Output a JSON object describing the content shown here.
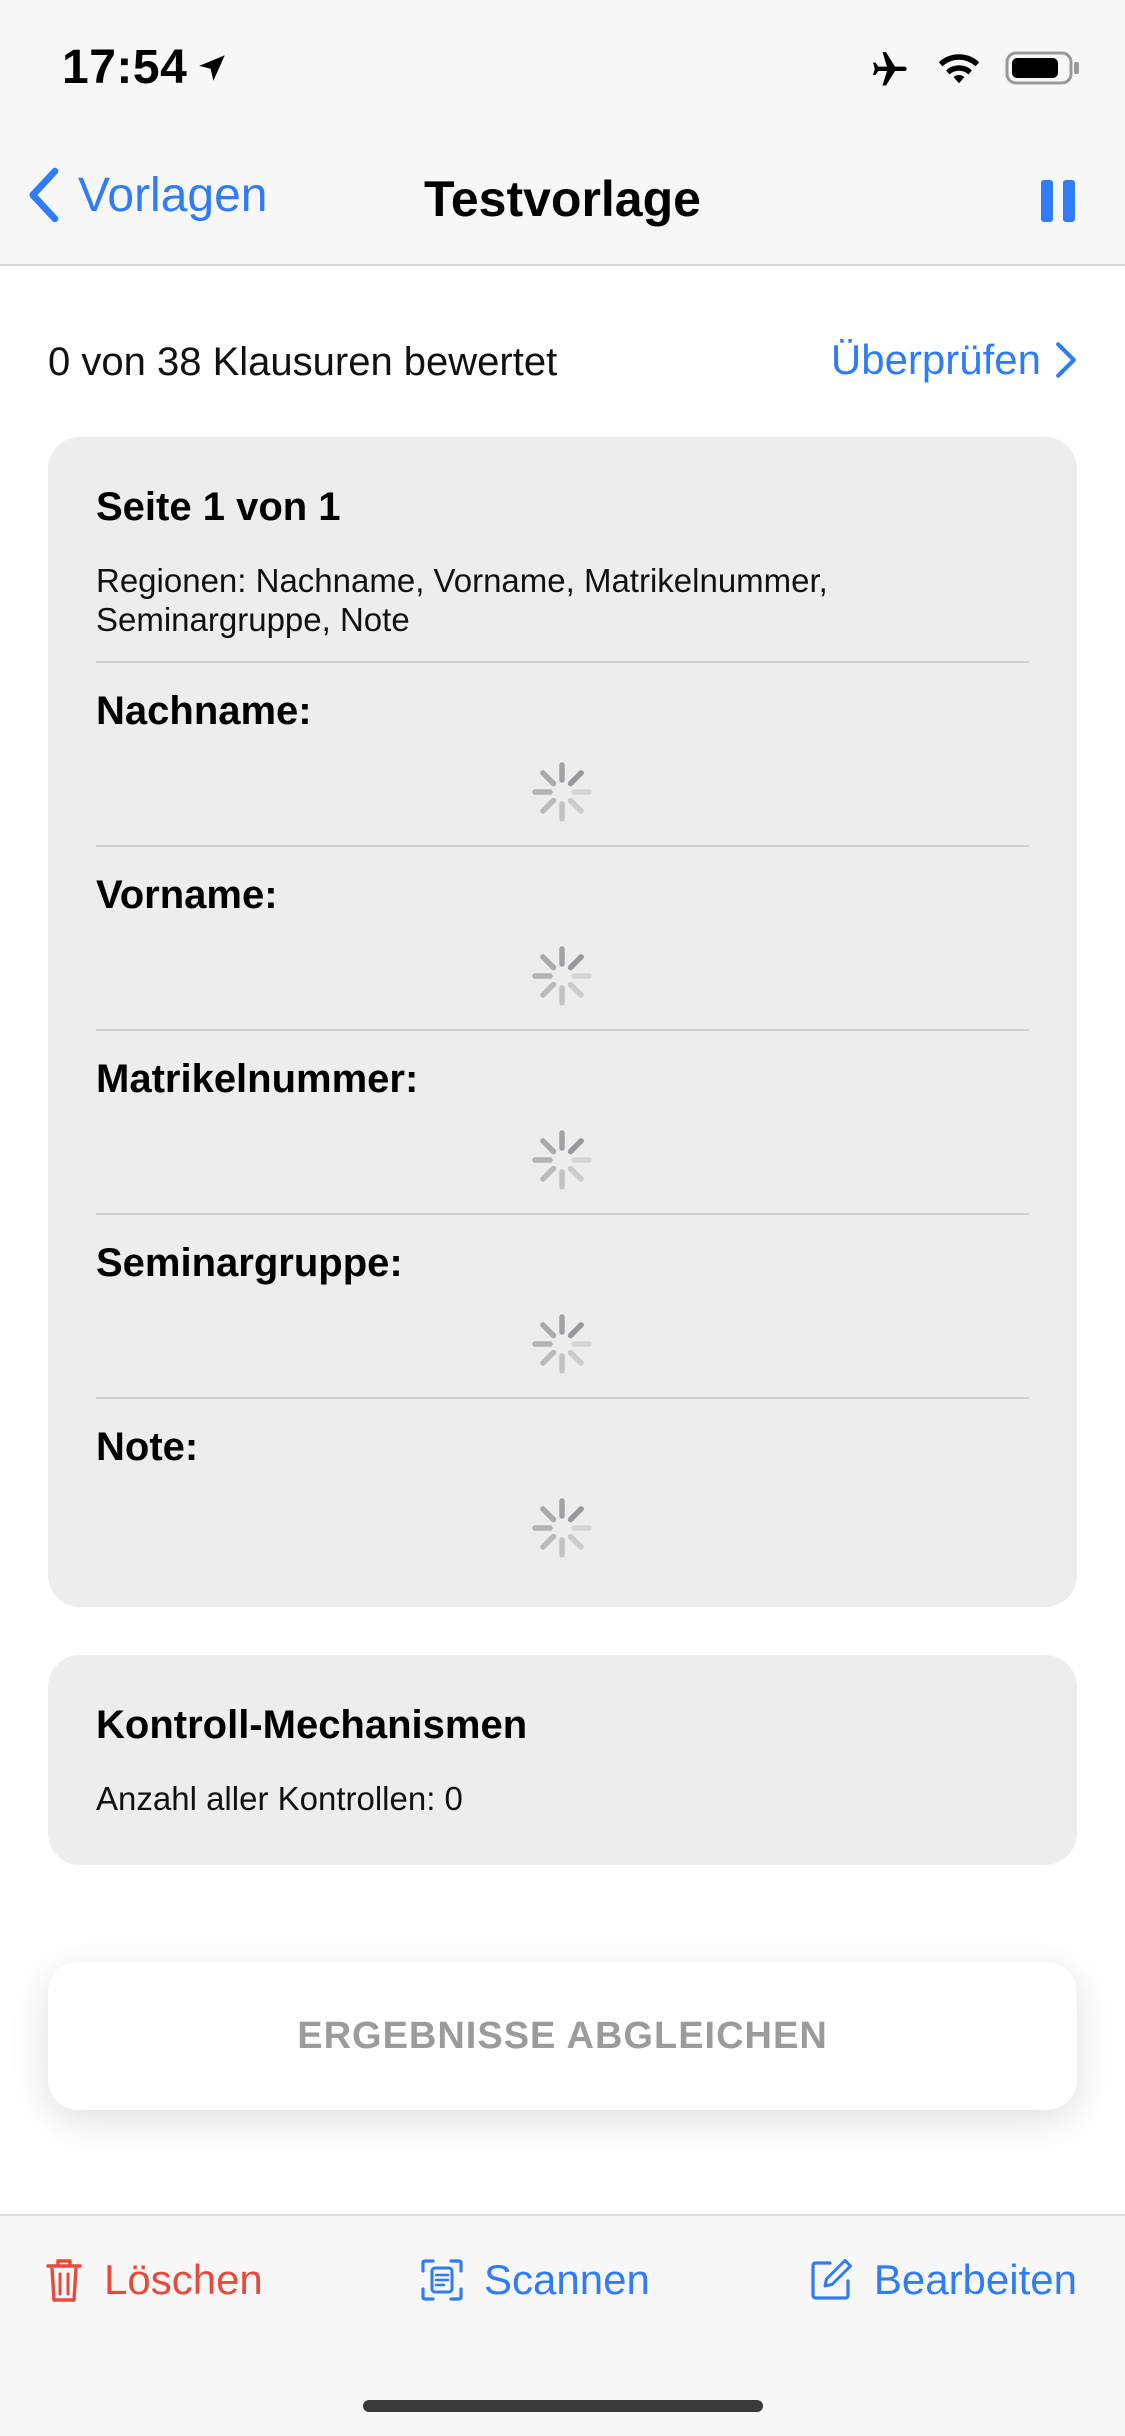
{
  "status_bar": {
    "time": "17:54"
  },
  "nav": {
    "back_label": "Vorlagen",
    "title": "Testvorlage"
  },
  "summary": {
    "progress_text": "0 von 38 Klausuren bewertet",
    "review_label": "Überprüfen"
  },
  "page_card": {
    "title": "Seite 1 von 1",
    "regions_text": "Regionen: Nachname, Vorname, Matrikelnummer, Seminargruppe, Note",
    "regions": [
      {
        "label": "Nachname:"
      },
      {
        "label": "Vorname:"
      },
      {
        "label": "Matrikelnummer:"
      },
      {
        "label": "Seminargruppe:"
      },
      {
        "label": "Note:"
      }
    ]
  },
  "control_card": {
    "title": "Kontroll-Mechanismen",
    "count_text": "Anzahl aller Kontrollen: 0"
  },
  "compare_button": {
    "label": "ERGEBNISSE ABGLEICHEN"
  },
  "toolbar": {
    "delete_label": "Löschen",
    "scan_label": "Scannen",
    "edit_label": "Bearbeiten"
  },
  "colors": {
    "accent": "#2f7cf6",
    "destructive": "#e54a3c",
    "card": "#ededed",
    "disabled_text": "#9b9b9b"
  },
  "icons": [
    "location-arrow-icon",
    "airplane-icon",
    "wifi-icon",
    "battery-icon",
    "chevron-left-icon",
    "pause-icon",
    "chevron-right-icon",
    "loading-spinner-icon",
    "trash-icon",
    "scan-icon",
    "edit-icon"
  ]
}
